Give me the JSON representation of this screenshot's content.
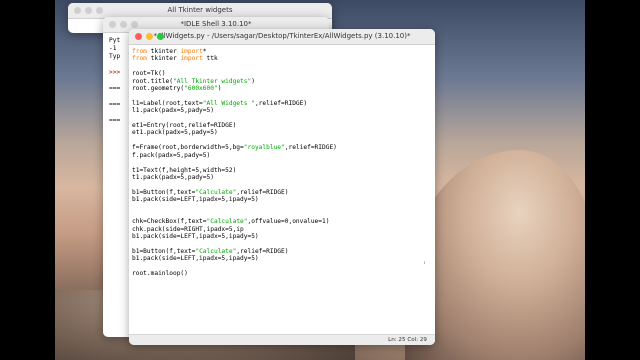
{
  "windows": {
    "back": {
      "title": "All Tkinter widgets"
    },
    "shell": {
      "title": "*IDLE Shell 3.10.10*",
      "lines": [
        "Pyt",
        "-1",
        "Typ",
        "",
        ">>>",
        "",
        "===",
        "",
        "===",
        "",
        "==="
      ]
    },
    "editor": {
      "title": "*AllWidgets.py - /Users/sagar/Desktop/TkinterEx/AllWidgets.py (3.10.10)*",
      "status": "Ln: 25  Col: 29"
    }
  },
  "code": [
    [
      {
        "t": "from",
        "c": "kw"
      },
      {
        "t": " tkinter "
      },
      {
        "t": "import",
        "c": "kw"
      },
      {
        "t": "*"
      }
    ],
    [
      {
        "t": "from",
        "c": "kw"
      },
      {
        "t": " tkinter "
      },
      {
        "t": "import",
        "c": "kw"
      },
      {
        "t": " ttk"
      }
    ],
    [],
    [
      {
        "t": "root=Tk()"
      }
    ],
    [
      {
        "t": "root.title("
      },
      {
        "t": "\"All Tkinter widgets\"",
        "c": "str"
      },
      {
        "t": ")"
      }
    ],
    [
      {
        "t": "root.geometry("
      },
      {
        "t": "\"600x600\"",
        "c": "str"
      },
      {
        "t": ")"
      }
    ],
    [],
    [
      {
        "t": "l1=Label(root,text="
      },
      {
        "t": "\"All Widgets \"",
        "c": "str"
      },
      {
        "t": ",relief=RIDGE)"
      }
    ],
    [
      {
        "t": "l1.pack(padx=5,pady=5)"
      }
    ],
    [],
    [
      {
        "t": "et1=Entry(root,relief=RIDGE)"
      }
    ],
    [
      {
        "t": "et1.pack(padx=5,pady=5)"
      }
    ],
    [],
    [
      {
        "t": "f=Frame(root,borderwidth=5,bg="
      },
      {
        "t": "\"royalblue\"",
        "c": "str"
      },
      {
        "t": ",relief=RIDGE)"
      }
    ],
    [
      {
        "t": "f.pack(padx=5,pady=5)"
      }
    ],
    [],
    [
      {
        "t": "t1=Text(f,height=5,width=52)"
      }
    ],
    [
      {
        "t": "t1.pack(padx=5,pady=5)"
      }
    ],
    [],
    [
      {
        "t": "b1=Button(f,text="
      },
      {
        "t": "\"Calculate\"",
        "c": "str"
      },
      {
        "t": ",relief=RIDGE)"
      }
    ],
    [
      {
        "t": "b1.pack(side=LEFT,ipadx=5,ipady=5)"
      }
    ],
    [],
    [],
    [
      {
        "t": "chk=CheckBox(f,text="
      },
      {
        "t": "\"Calculate\"",
        "c": "str"
      },
      {
        "t": ",offvalue=0,onvalue=1)"
      }
    ],
    [
      {
        "t": "chk.pack(side=RIGHT,ipadx=5,ip"
      }
    ],
    [
      {
        "t": "b1.pack(side=LEFT,ipadx=5,ipady=5)"
      }
    ],
    [],
    [
      {
        "t": "b1=Button(f,text="
      },
      {
        "t": "\"Calculate\"",
        "c": "str"
      },
      {
        "t": ",relief=RIDGE)"
      }
    ],
    [
      {
        "t": "b1.pack(side=LEFT,ipadx=5,ipady=5)"
      }
    ],
    [],
    [
      {
        "t": "root.mainloop()"
      }
    ]
  ]
}
